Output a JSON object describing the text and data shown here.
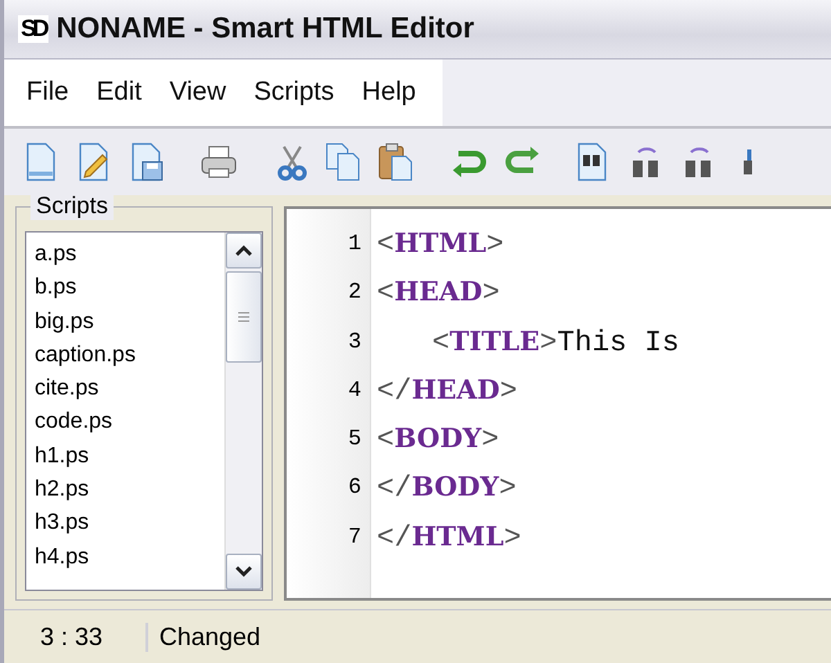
{
  "window": {
    "title": "NONAME - Smart HTML Editor",
    "logo": "SD"
  },
  "menu": [
    {
      "label": "File"
    },
    {
      "label": "Edit"
    },
    {
      "label": "View"
    },
    {
      "label": "Scripts"
    },
    {
      "label": "Help"
    }
  ],
  "scripts_panel": {
    "title": "Scripts",
    "items": [
      {
        "label": "a.ps",
        "selected": false
      },
      {
        "label": "b.ps",
        "selected": false
      },
      {
        "label": "big.ps",
        "selected": false
      },
      {
        "label": "caption.ps",
        "selected": false
      },
      {
        "label": "cite.ps",
        "selected": false
      },
      {
        "label": "code.ps",
        "selected": false
      },
      {
        "label": "h1.ps",
        "selected": false
      },
      {
        "label": "h2.ps",
        "selected": false
      },
      {
        "label": "h3.ps",
        "selected": false
      },
      {
        "label": "h4.ps",
        "selected": false
      }
    ]
  },
  "editor": {
    "lines": [
      {
        "number": "1",
        "indent": false,
        "segments": [
          {
            "kind": "bracket",
            "text": "<"
          },
          {
            "kind": "tag",
            "text": "HTML"
          },
          {
            "kind": "bracket",
            "text": ">"
          }
        ]
      },
      {
        "number": "2",
        "indent": false,
        "segments": [
          {
            "kind": "bracket",
            "text": "<"
          },
          {
            "kind": "tag",
            "text": "HEAD"
          },
          {
            "kind": "bracket",
            "text": ">"
          }
        ]
      },
      {
        "number": "3",
        "indent": true,
        "segments": [
          {
            "kind": "bracket",
            "text": "<"
          },
          {
            "kind": "tag",
            "text": "TITLE"
          },
          {
            "kind": "bracket",
            "text": ">"
          },
          {
            "kind": "text",
            "text": "This Is"
          }
        ]
      },
      {
        "number": "4",
        "indent": false,
        "segments": [
          {
            "kind": "bracket",
            "text": "</"
          },
          {
            "kind": "tag",
            "text": "HEAD"
          },
          {
            "kind": "bracket",
            "text": ">"
          }
        ]
      },
      {
        "number": "5",
        "indent": false,
        "segments": [
          {
            "kind": "bracket",
            "text": "<"
          },
          {
            "kind": "tag",
            "text": "BODY"
          },
          {
            "kind": "bracket",
            "text": ">"
          }
        ]
      },
      {
        "number": "6",
        "indent": false,
        "segments": [
          {
            "kind": "bracket",
            "text": "</"
          },
          {
            "kind": "tag",
            "text": "BODY"
          },
          {
            "kind": "bracket",
            "text": ">"
          }
        ]
      },
      {
        "number": "7",
        "indent": false,
        "segments": [
          {
            "kind": "bracket",
            "text": "</"
          },
          {
            "kind": "tag",
            "text": "HTML"
          },
          {
            "kind": "bracket",
            "text": ">"
          }
        ]
      }
    ]
  },
  "status_bar": {
    "position": "3 : 33",
    "state": "Changed"
  }
}
